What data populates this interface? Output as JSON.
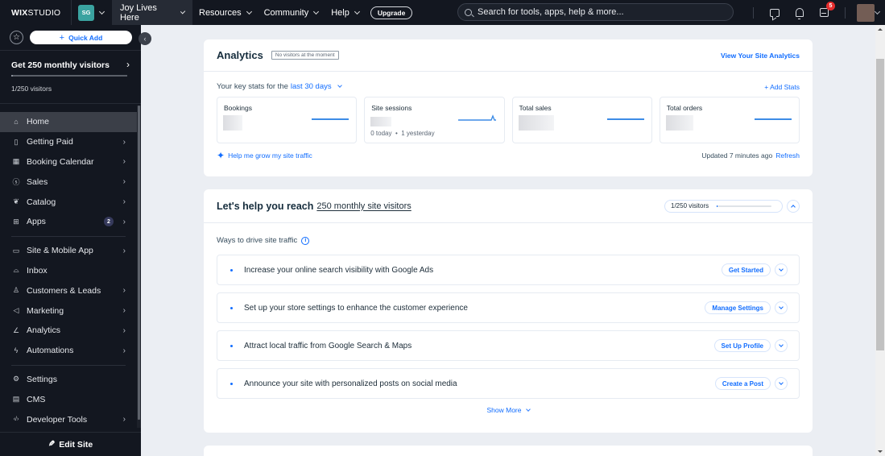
{
  "topbar": {
    "logo_bold": "WIX",
    "logo_rest": "STUDIO",
    "workspace_initials": "SG",
    "site_name": "Joy Lives Here",
    "nav": [
      {
        "label": "Resources"
      },
      {
        "label": "Community"
      },
      {
        "label": "Help"
      }
    ],
    "upgrade_label": "Upgrade",
    "search_placeholder": "Search for tools, apps, help & more...",
    "notifications_count": "5",
    "icons": [
      "chat-icon",
      "bell-icon",
      "inbox-icon"
    ]
  },
  "sidebar": {
    "quick_add_label": "Quick Add",
    "goal": {
      "title": "Get 250 monthly visitors",
      "progress_text": "1/250 visitors",
      "progress_fraction": 0.004
    },
    "groups": [
      [
        {
          "label": "Home",
          "icon": "home-icon",
          "active": true,
          "has_arrow": false
        },
        {
          "label": "Getting Paid",
          "icon": "getting-paid-icon",
          "has_arrow": true
        },
        {
          "label": "Booking Calendar",
          "icon": "calendar-icon",
          "has_arrow": true
        },
        {
          "label": "Sales",
          "icon": "dollar-icon",
          "has_arrow": true
        },
        {
          "label": "Catalog",
          "icon": "catalog-icon",
          "has_arrow": true
        },
        {
          "label": "Apps",
          "icon": "apps-icon",
          "has_arrow": true,
          "badge": "2"
        }
      ],
      [
        {
          "label": "Site & Mobile App",
          "icon": "site-mobile-icon",
          "has_arrow": true
        },
        {
          "label": "Inbox",
          "icon": "inbox-icon",
          "has_arrow": false
        },
        {
          "label": "Customers & Leads",
          "icon": "customers-icon",
          "has_arrow": true
        },
        {
          "label": "Marketing",
          "icon": "megaphone-icon",
          "has_arrow": true
        },
        {
          "label": "Analytics",
          "icon": "analytics-icon",
          "has_arrow": true
        },
        {
          "label": "Automations",
          "icon": "automations-icon",
          "has_arrow": true
        }
      ],
      [
        {
          "label": "Settings",
          "icon": "gear-icon",
          "has_arrow": false
        },
        {
          "label": "CMS",
          "icon": "cms-icon",
          "has_arrow": false
        },
        {
          "label": "Developer Tools",
          "icon": "code-icon",
          "has_arrow": true
        }
      ]
    ],
    "edit_site_label": "Edit Site"
  },
  "analytics": {
    "title": "Analytics",
    "status_badge": "No visitors at the moment",
    "view_link": "View Your Site Analytics",
    "key_stats_prefix": "Your key stats for the",
    "range": "last 30 days",
    "add_stats": "Add Stats",
    "stats": [
      {
        "label": "Bookings",
        "sub": ""
      },
      {
        "label": "Site sessions",
        "sub_today": "0 today",
        "sub_yesterday": "1 yesterday"
      },
      {
        "label": "Total sales",
        "sub": ""
      },
      {
        "label": "Total orders",
        "sub": ""
      }
    ],
    "grow_link": "Help me grow my site traffic",
    "updated": "Updated 7 minutes ago",
    "refresh": "Refresh"
  },
  "reach": {
    "title": "Let's help you reach",
    "goal_link": "250 monthly site visitors",
    "progress_text": "1/250 visitors",
    "progress_fraction": 0.004,
    "ways_label": "Ways to drive site traffic",
    "tasks": [
      {
        "text": "Increase your online search visibility with Google Ads",
        "action": "Get Started"
      },
      {
        "text": "Set up your store settings to enhance the customer experience",
        "action": "Manage Settings"
      },
      {
        "text": "Attract local traffic from Google Search & Maps",
        "action": "Set Up Profile"
      },
      {
        "text": "Announce your site with personalized posts on social media",
        "action": "Create a Post"
      }
    ],
    "show_more": "Show More"
  },
  "colors": {
    "accent": "#116dff",
    "topbar_bg": "#131720",
    "sidebar_bg": "#131720",
    "page_bg": "#ebeef3",
    "notification_badge": "#e62d2d",
    "workspace_badge": "#3aa3a0"
  }
}
